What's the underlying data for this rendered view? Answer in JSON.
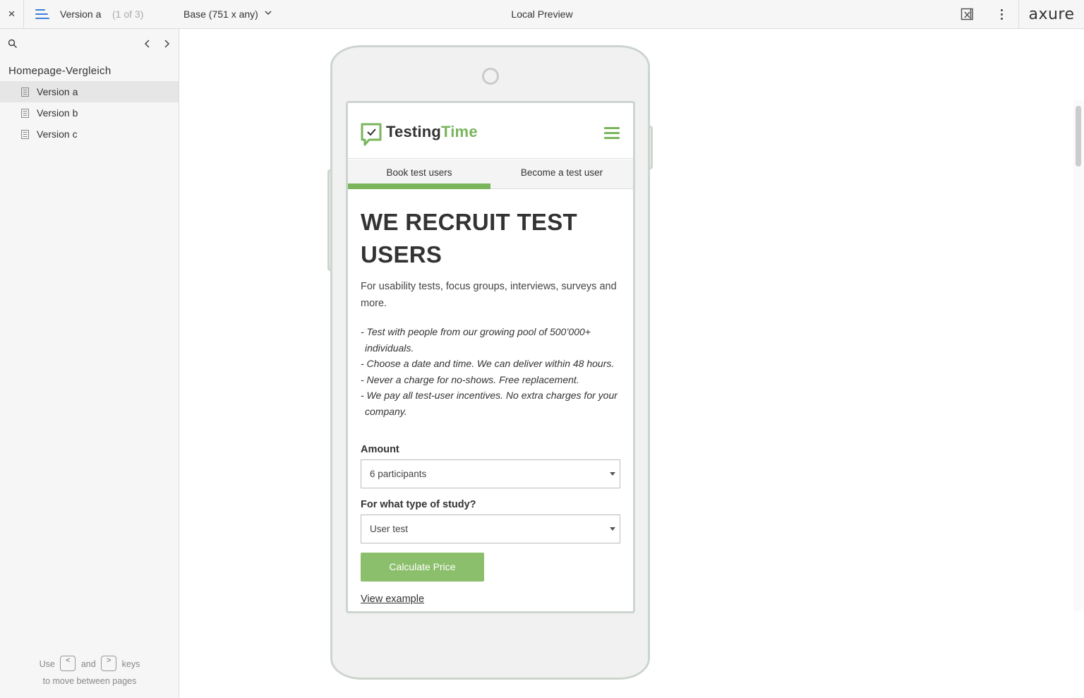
{
  "toolbar": {
    "close_label": "×",
    "page_name": "Version a",
    "page_count": "(1 of 3)",
    "adaptive_view": "Base (751 x any)",
    "title": "Local Preview",
    "logo": "axure"
  },
  "sidebar": {
    "folder": "Homepage-Vergleich",
    "pages": [
      {
        "label": "Version a",
        "active": true
      },
      {
        "label": "Version b",
        "active": false
      },
      {
        "label": "Version c",
        "active": false
      }
    ],
    "hint": {
      "use": "Use",
      "and": "and",
      "keys": "keys",
      "line2": "to move between pages",
      "key_left": "<",
      "key_right": ">"
    }
  },
  "site": {
    "brand_part1": "Testing",
    "brand_part2": "Time",
    "brand_color": "#7ab55c",
    "tabs": [
      {
        "label": "Book test users",
        "active": true
      },
      {
        "label": "Become a test user",
        "active": false
      }
    ],
    "headline": "WE RECRUIT TEST USERS",
    "subtitle": "For usability tests, focus groups, interviews, surveys and more.",
    "bullets": [
      "- Test with people from our growing pool of 500’000+ individuals.",
      "- Choose a date and time. We can deliver within 48 hours.",
      "- Never a charge for no-shows. Free replacement.",
      "- We pay all test-user incentives. No extra charges for your company."
    ],
    "amount_label": "Amount",
    "amount_value": "6 participants",
    "study_label": "For what type of study?",
    "study_value": "User test",
    "calculate_button": "Calculate Price",
    "view_example": "View example"
  }
}
